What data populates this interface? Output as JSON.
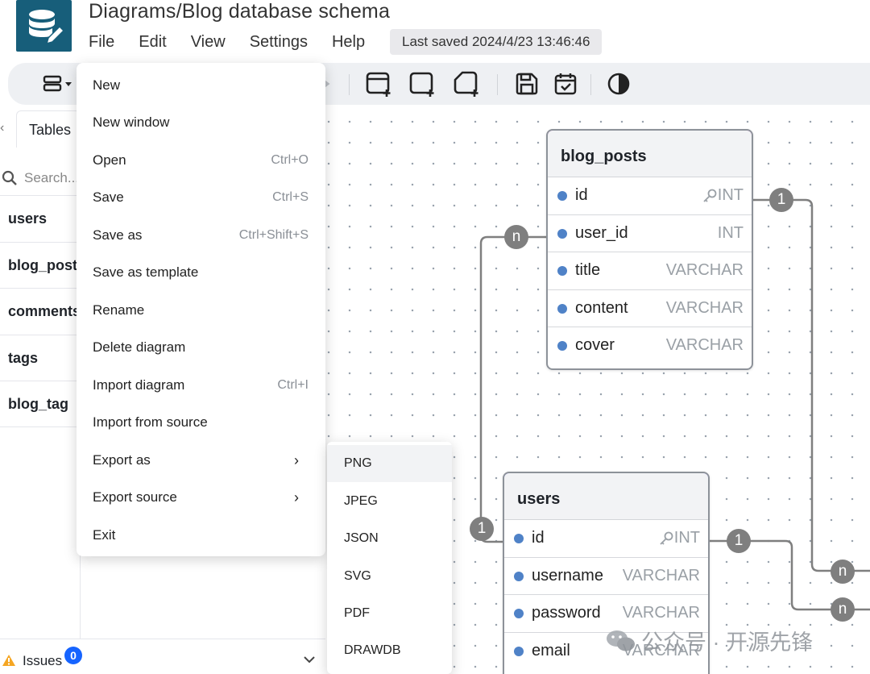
{
  "app": {
    "title": "Diagrams/Blog database schema",
    "menus": [
      "File",
      "Edit",
      "View",
      "Settings",
      "Help"
    ],
    "last_saved": "Last saved 2024/4/23 13:46:46"
  },
  "colors": {
    "blog_posts_accent": "#b64fc8",
    "users_accent": "#6461f2",
    "logo_bg": "#175e7a",
    "badge": "#1664ff"
  },
  "sidebar": {
    "tab": "Tables",
    "search_placeholder": "Search...",
    "tables": [
      "users",
      "blog_posts",
      "comments",
      "tags",
      "blog_tag"
    ],
    "issues_label": "Issues",
    "issues_count": "0"
  },
  "file_menu": {
    "items": [
      {
        "label": "New",
        "shortcut": ""
      },
      {
        "label": "New window",
        "shortcut": ""
      },
      {
        "label": "Open",
        "shortcut": "Ctrl+O"
      },
      {
        "label": "Save",
        "shortcut": "Ctrl+S"
      },
      {
        "label": "Save as",
        "shortcut": "Ctrl+Shift+S"
      },
      {
        "label": "Save as template",
        "shortcut": ""
      },
      {
        "label": "Rename",
        "shortcut": ""
      },
      {
        "label": "Delete diagram",
        "shortcut": ""
      },
      {
        "label": "Import diagram",
        "shortcut": "Ctrl+I"
      },
      {
        "label": "Import from source",
        "shortcut": ""
      },
      {
        "label": "Export as",
        "shortcut": "",
        "submenu": true
      },
      {
        "label": "Export source",
        "shortcut": "",
        "submenu": true
      },
      {
        "label": "Exit",
        "shortcut": ""
      }
    ]
  },
  "export_submenu": [
    "PNG",
    "JPEG",
    "JSON",
    "SVG",
    "PDF",
    "DRAWDB"
  ],
  "diagram": {
    "blog_posts": {
      "name": "blog_posts",
      "fields": [
        {
          "name": "id",
          "type": "INT",
          "pk": true
        },
        {
          "name": "user_id",
          "type": "INT",
          "pk": false
        },
        {
          "name": "title",
          "type": "VARCHAR",
          "pk": false
        },
        {
          "name": "content",
          "type": "VARCHAR",
          "pk": false
        },
        {
          "name": "cover",
          "type": "VARCHAR",
          "pk": false
        }
      ]
    },
    "users": {
      "name": "users",
      "fields": [
        {
          "name": "id",
          "type": "INT",
          "pk": true
        },
        {
          "name": "username",
          "type": "VARCHAR",
          "pk": false
        },
        {
          "name": "password",
          "type": "VARCHAR",
          "pk": false
        },
        {
          "name": "email",
          "type": "VARCHAR",
          "pk": false
        }
      ]
    },
    "relations": {
      "one": "1",
      "many": "n"
    }
  },
  "watermark": "公众号 · 开源先锋"
}
